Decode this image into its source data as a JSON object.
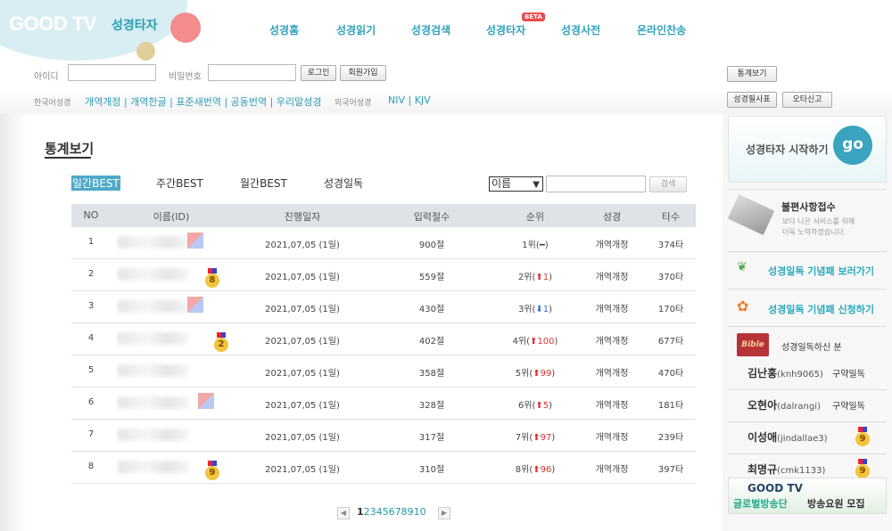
{
  "logo": {
    "brand": "GOOD TV",
    "service": "성경타자"
  },
  "gnb": [
    "성경홈",
    "성경읽기",
    "성경검색",
    "성경타자",
    "성경사전",
    "온라인찬송"
  ],
  "beta": "BETA",
  "login": {
    "id_label": "아이디",
    "pw_label": "비밀번호",
    "login_btn": "로그인",
    "join_btn": "회원가입",
    "stats_btn": "통계보기",
    "cert_btn": "성경필사표",
    "typo_btn": "오타신고"
  },
  "bibles": {
    "korean_label": "한국어성경",
    "korean_versions": "개역개정 | 개역한글 | 표준새번역 | 공동번역 | 우리말성경",
    "foreign_label": "외국어성경",
    "foreign_versions": "NIV | KJV"
  },
  "page": {
    "title": "통계보기"
  },
  "tabs": [
    "일간BEST",
    "주간BEST",
    "월간BEST",
    "성경일독"
  ],
  "search": {
    "select": "이름",
    "button": "검색"
  },
  "table": {
    "headers": [
      "NO",
      "이름(ID)",
      "진행일자",
      "입력절수",
      "순위",
      "성경",
      "타수"
    ],
    "rows": [
      {
        "no": "1",
        "date": "2021,07,05 (1일)",
        "verses": "900절",
        "rank": "1위(",
        "dir": "same",
        "change": "━",
        "rank_end": ")",
        "bible": "개역개정",
        "hits": "374타",
        "badge": ""
      },
      {
        "no": "2",
        "date": "2021,07,05 (1일)",
        "verses": "559절",
        "rank": "2위(",
        "dir": "up",
        "change": "⬆1",
        "rank_end": ")",
        "bible": "개역개정",
        "hits": "370타",
        "badge": "8"
      },
      {
        "no": "3",
        "date": "2021,07,05 (1일)",
        "verses": "430절",
        "rank": "3위(",
        "dir": "down",
        "change": "⬇1",
        "rank_end": ")",
        "bible": "개역개정",
        "hits": "170타",
        "badge": ""
      },
      {
        "no": "4",
        "date": "2021,07,05 (1일)",
        "verses": "402절",
        "rank": "4위(",
        "dir": "up",
        "change": "⬆100",
        "rank_end": ")",
        "bible": "개역개정",
        "hits": "677타",
        "badge": "2"
      },
      {
        "no": "5",
        "date": "2021,07,05 (1일)",
        "verses": "358절",
        "rank": "5위(",
        "dir": "up",
        "change": "⬆99",
        "rank_end": ")",
        "bible": "개역개정",
        "hits": "470타",
        "badge": ""
      },
      {
        "no": "6",
        "date": "2021,07,05 (1일)",
        "verses": "328절",
        "rank": "6위(",
        "dir": "up",
        "change": "⬆5",
        "rank_end": ")",
        "bible": "개역개정",
        "hits": "181타",
        "badge": ""
      },
      {
        "no": "7",
        "date": "2021,07,05 (1일)",
        "verses": "317절",
        "rank": "7위(",
        "dir": "up",
        "change": "⬆97",
        "rank_end": ")",
        "bible": "개역개정",
        "hits": "239타",
        "badge": ""
      },
      {
        "no": "8",
        "date": "2021,07,05 (1일)",
        "verses": "310절",
        "rank": "8위(",
        "dir": "up",
        "change": "⬆96",
        "rank_end": ")",
        "bible": "개역개정",
        "hits": "397타",
        "badge": "9"
      }
    ]
  },
  "pager": {
    "current": "1",
    "pages": "2345678910"
  },
  "sidebar": {
    "start": "성경타자 시작하기",
    "go": "go",
    "complaint_title": "불편사항접수",
    "complaint_desc1": "보다 나은 서비스를 위해",
    "complaint_desc2": "더욱 노력하겠습니다.",
    "plaque_view": "성경일독 기념패 보러가기",
    "plaque_apply": "성경일독 기념패 신청하기",
    "bible_icon": "Bible",
    "readers_title": "성경일독하신 분",
    "readers": [
      {
        "name": "김난홍",
        "id": "(knh9065)",
        "note": "구약일독"
      },
      {
        "name": "오현아",
        "id": "(dalrangi)",
        "note": "구약일독"
      },
      {
        "name": "이성애",
        "id": "(jindallae3)",
        "note": "9"
      },
      {
        "name": "최명규",
        "id": "(cmk1133)",
        "note": "9"
      }
    ],
    "banner_brand": "GOOD TV",
    "banner_text1": "글로벌방송단",
    "banner_text2": "방송요원 모집"
  }
}
